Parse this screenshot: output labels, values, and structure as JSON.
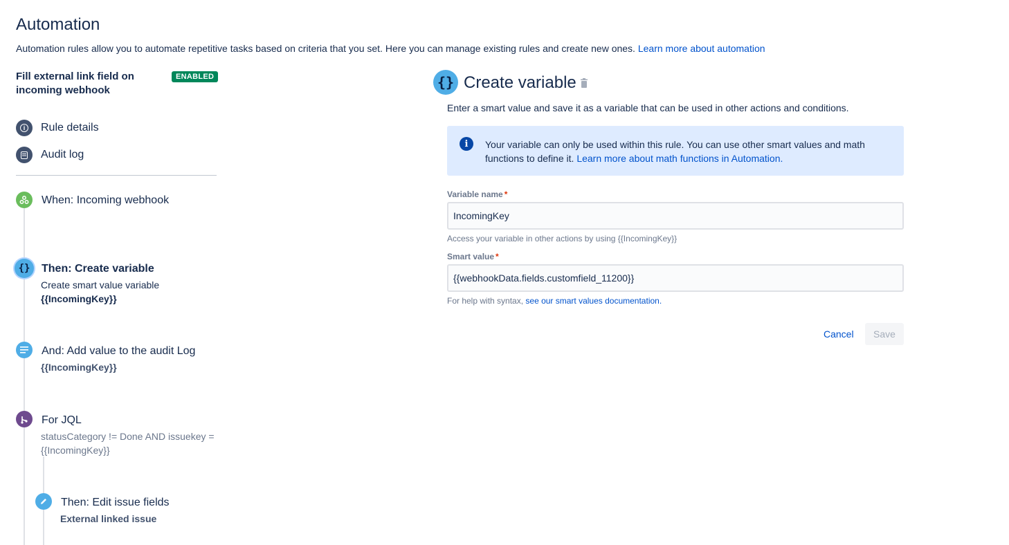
{
  "header": {
    "title": "Automation",
    "description": "Automation rules allow you to automate repetitive tasks based on criteria that you set. Here you can manage existing rules and create new ones.",
    "learn_more": "Learn more about automation"
  },
  "rule": {
    "name": "Fill external link field on incoming webhook",
    "status": "ENABLED",
    "status_color": "#00875a"
  },
  "nav": {
    "items": [
      {
        "label": "Rule details",
        "icon": "info-icon"
      },
      {
        "label": "Audit log",
        "icon": "list-icon"
      }
    ]
  },
  "steps": [
    {
      "title": "When: Incoming webhook",
      "icon": "webhook-icon",
      "color": "#6abd5c"
    },
    {
      "title": "Then: Create variable",
      "subtitle": "Create smart value variable",
      "value": "{{IncomingKey}}",
      "icon": "braces-icon",
      "color": "#4fade6"
    },
    {
      "title": "And: Add value to the audit Log",
      "value": "{{IncomingKey}}",
      "icon": "log-icon",
      "color": "#4fade6"
    },
    {
      "title": "For JQL",
      "detail_1": "statusCategory != Done AND issuekey =",
      "detail_2": "{{IncomingKey}}",
      "icon": "branch-icon",
      "color": "#6e4a8e"
    },
    {
      "title": "Then: Edit issue fields",
      "value": "External linked issue",
      "icon": "pencil-icon",
      "color": "#4fade6"
    }
  ],
  "panel": {
    "title": "Create variable",
    "description": "Enter a smart value and save it as a variable that can be used in other actions and conditions.",
    "info": {
      "text": "Your variable can only be used within this rule. You can use other smart values and math functions to define it.",
      "link": "Learn more about math functions in Automation."
    },
    "variable_name": {
      "label": "Variable name",
      "value": "IncomingKey",
      "help": "Access your variable in other actions by using {{IncomingKey}}"
    },
    "smart_value": {
      "label": "Smart value",
      "value": "{{webhookData.fields.customfield_11200}}",
      "help_prefix": "For help with syntax,",
      "help_link": "see our smart values documentation."
    },
    "cancel_label": "Cancel",
    "save_label": "Save",
    "required_mark": "*"
  }
}
